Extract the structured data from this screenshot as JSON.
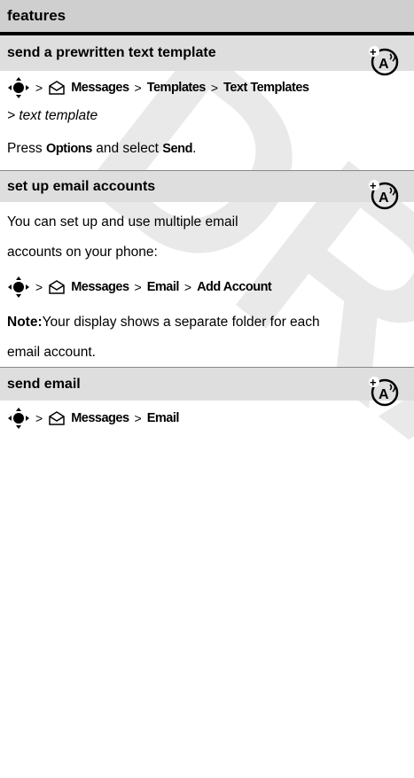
{
  "watermark": "DRAFT",
  "header": {
    "title": "features"
  },
  "sections": [
    {
      "title": "send a prewritten text template",
      "nav": [
        "Messages",
        "Templates",
        "Text Templates"
      ],
      "nav2": "> text template",
      "press_prefix": "Press ",
      "press_key": "Options",
      "press_mid": " and select ",
      "press_action": "Send",
      "press_suffix": "."
    },
    {
      "title": "set up email accounts",
      "body1": "You can set up and use multiple email",
      "body2": "accounts on your phone:",
      "nav": [
        "Messages",
        "Email",
        "Add Account"
      ],
      "note_label": "Note:",
      "note1": " Your display shows a separate folder for each",
      "note2": "email account."
    },
    {
      "title": "send email",
      "nav": [
        "Messages",
        "Email"
      ]
    }
  ],
  "icons": {
    "nav_key": "navigation-key-icon",
    "messages": "envelope-icon",
    "network": "network-feature-icon"
  }
}
